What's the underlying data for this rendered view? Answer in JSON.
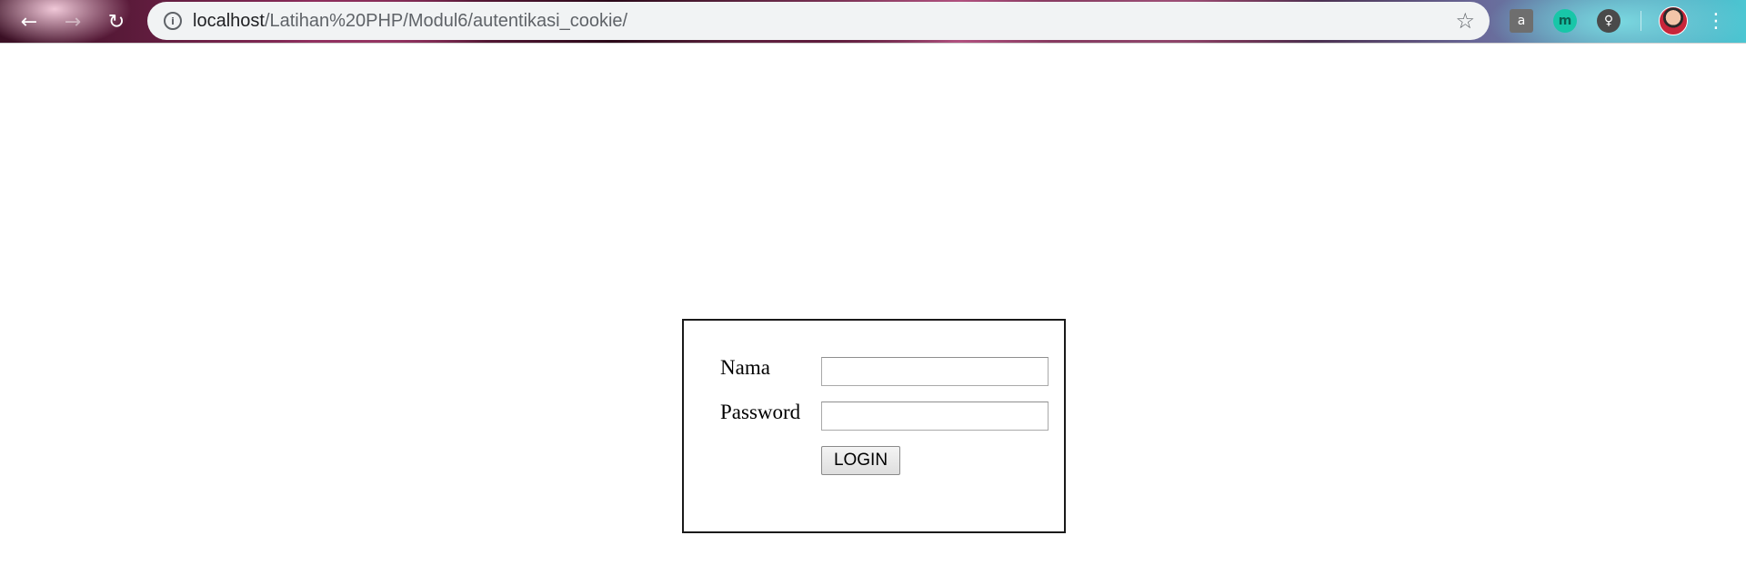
{
  "browser": {
    "url_host": "localhost",
    "url_path": "/Latihan%20PHP/Modul6/autentikasi_cookie/",
    "icons": {
      "back": "back-arrow-icon",
      "forward": "forward-arrow-icon",
      "reload": "reload-icon",
      "info": "info-icon",
      "star": "star-icon",
      "menu": "menu-icon"
    },
    "extensions": [
      {
        "name": "shopping-bag-extension-icon",
        "glyph": "a"
      },
      {
        "name": "m-extension-icon",
        "glyph": "m"
      },
      {
        "name": "lightbulb-extension-icon",
        "glyph": "♀"
      }
    ]
  },
  "login": {
    "nama_label": "Nama",
    "nama_value": "",
    "password_label": "Password",
    "password_value": "",
    "button_label": "LOGIN"
  },
  "colors": {
    "omnibox_bg": "#f1f3f4",
    "form_border": "#1a1a1a"
  }
}
